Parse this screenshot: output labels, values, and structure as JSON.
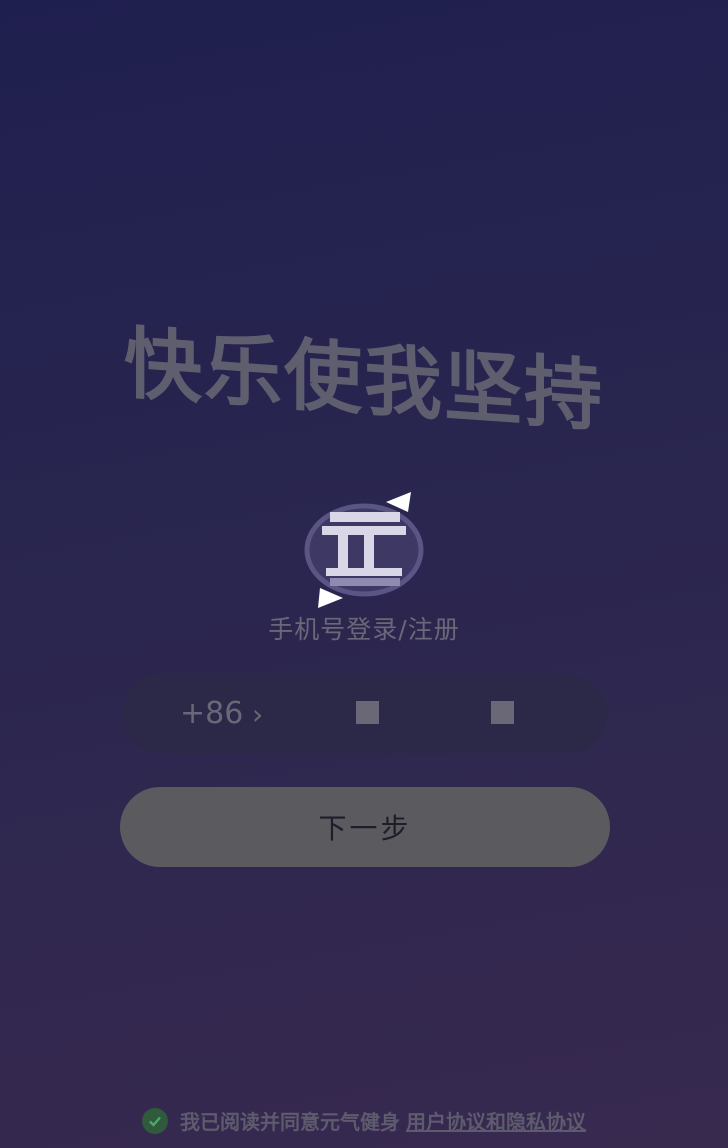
{
  "slogan": "快乐使我坚持",
  "logo_icon": "yuan-logo-icon",
  "login_title": "手机号登录/注册",
  "phone": {
    "country_code": "+86",
    "arrow": "›"
  },
  "next_button": "下一步",
  "agreement": {
    "text": "我已阅读并同意元气健身",
    "link": "用户协议和隐私协议",
    "check_icon": "check-circle-icon"
  },
  "colors": {
    "bg_top": "#1f1f4f",
    "bg_bottom": "#38294f",
    "check": "#2f5a3c"
  }
}
